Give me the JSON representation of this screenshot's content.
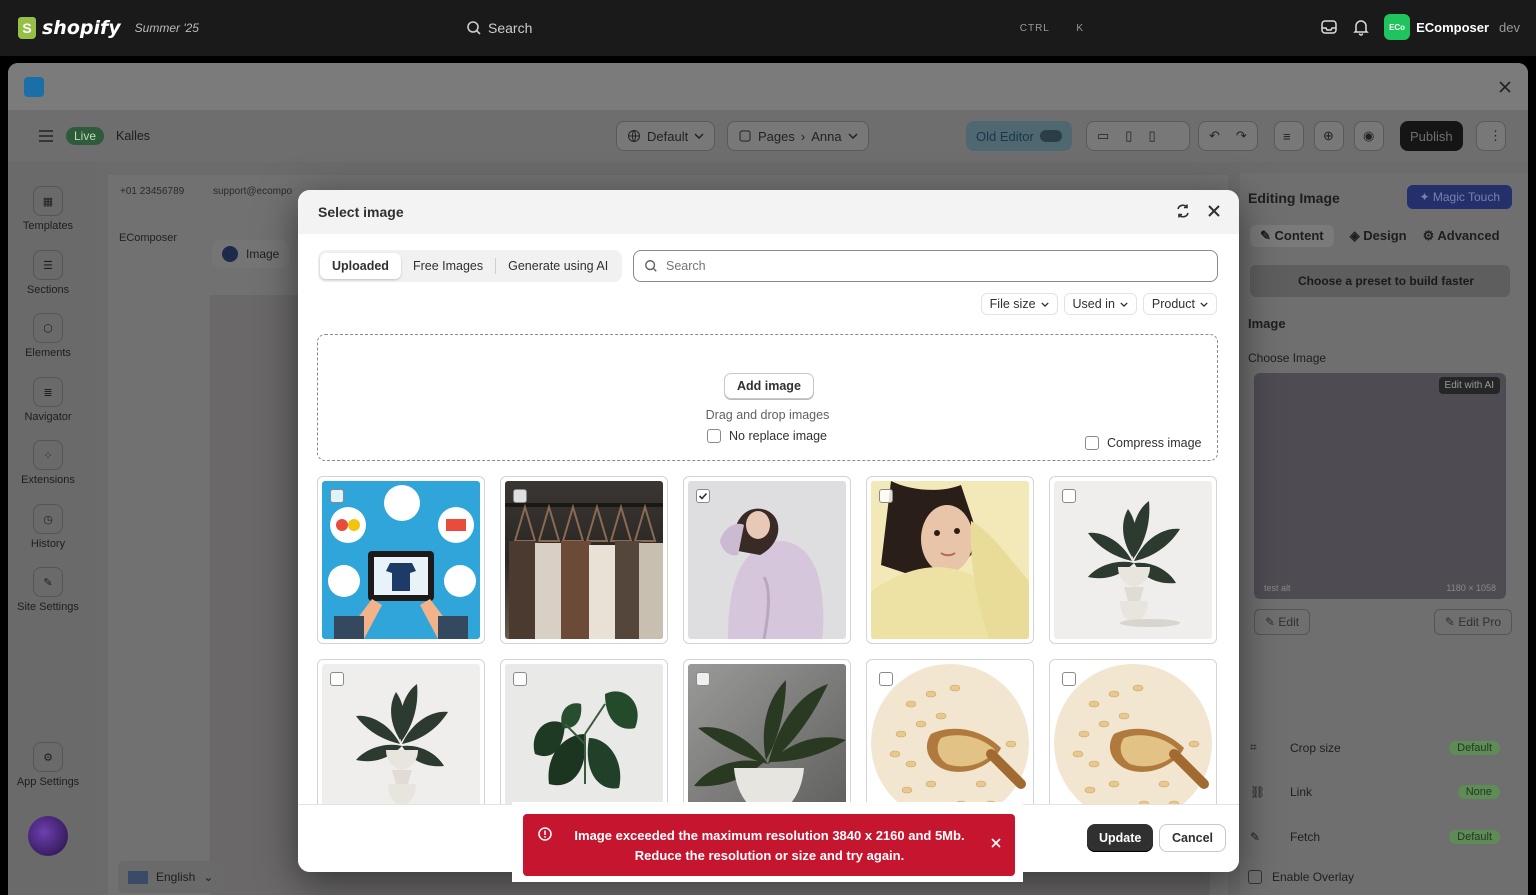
{
  "shopify": {
    "brand": "shopify",
    "edition": "Summer '25",
    "search_placeholder": "Search",
    "shortcut_ctrl": "CTRL",
    "shortcut_key": "K",
    "store_badge": "ECo",
    "store_name": "EComposer",
    "store_env": "dev"
  },
  "editor": {
    "status": "Live",
    "theme": "Kalles",
    "template": "Default",
    "page_type": "Pages",
    "page_name": "Anna",
    "old_editor": "Old Editor",
    "publish": "Publish",
    "canvas_phone": "+01 23456789",
    "canvas_email": "support@ecompo",
    "canvas_brand": "EComposer",
    "canvas_chip": "Image",
    "language": "English"
  },
  "sidebar": {
    "items": [
      {
        "label": "Templates"
      },
      {
        "label": "Sections"
      },
      {
        "label": "Elements"
      },
      {
        "label": "Navigator"
      },
      {
        "label": "Extensions"
      },
      {
        "label": "History"
      },
      {
        "label": "Site Settings"
      }
    ],
    "app_settings": "App Settings"
  },
  "right_panel": {
    "title": "Editing Image",
    "magic": "Magic Touch",
    "tabs": {
      "content": "Content",
      "design": "Design",
      "advanced": "Advanced"
    },
    "preset": "Choose a preset to build faster",
    "section": "Image",
    "choose_image": "Choose Image",
    "edit_ai": "Edit with AI",
    "alt": "test alt",
    "dims": "1180 × 1058",
    "edit": "Edit",
    "edit_pro": "Edit Pro",
    "rows": [
      {
        "label": "Crop size",
        "value": "Default"
      },
      {
        "label": "Link",
        "value": "None"
      },
      {
        "label": "Fetch",
        "value": "Default"
      }
    ],
    "overlay": "Enable Overlay"
  },
  "modal": {
    "title": "Select image",
    "tabs": [
      {
        "label": "Uploaded",
        "active": true
      },
      {
        "label": "Free Images",
        "active": false
      },
      {
        "label": "Generate using AI",
        "active": false
      }
    ],
    "search_placeholder": "Search",
    "filters": [
      "File size",
      "Used in",
      "Product"
    ],
    "add_image": "Add image",
    "drag_text": "Drag and drop images",
    "no_replace": "No replace image",
    "compress": "Compress image",
    "images": [
      {
        "name": "ecommerce-illustration",
        "checked": false
      },
      {
        "name": "clothes-rack",
        "checked": false
      },
      {
        "name": "woman-pink-hoodie",
        "checked": true
      },
      {
        "name": "woman-yellow-sweater",
        "checked": false
      },
      {
        "name": "plant-white-vase",
        "checked": false
      },
      {
        "name": "plant-white-vase-2",
        "checked": false
      },
      {
        "name": "monstera-plant",
        "checked": false
      },
      {
        "name": "potted-plant-gray",
        "checked": false
      },
      {
        "name": "oats-scoop",
        "checked": false
      },
      {
        "name": "oats-scoop-2",
        "checked": false
      }
    ],
    "update": "Update",
    "cancel": "Cancel"
  },
  "toast": {
    "line1": "Image exceeded the maximum resolution 3840 x 2160 and 5Mb.",
    "line2": "Reduce the resolution or size and try again."
  },
  "colors": {
    "toast_bg": "#c5152f",
    "primary_button": "#303030",
    "shopify_green": "#95bf47",
    "store_badge": "#1fc55c"
  }
}
